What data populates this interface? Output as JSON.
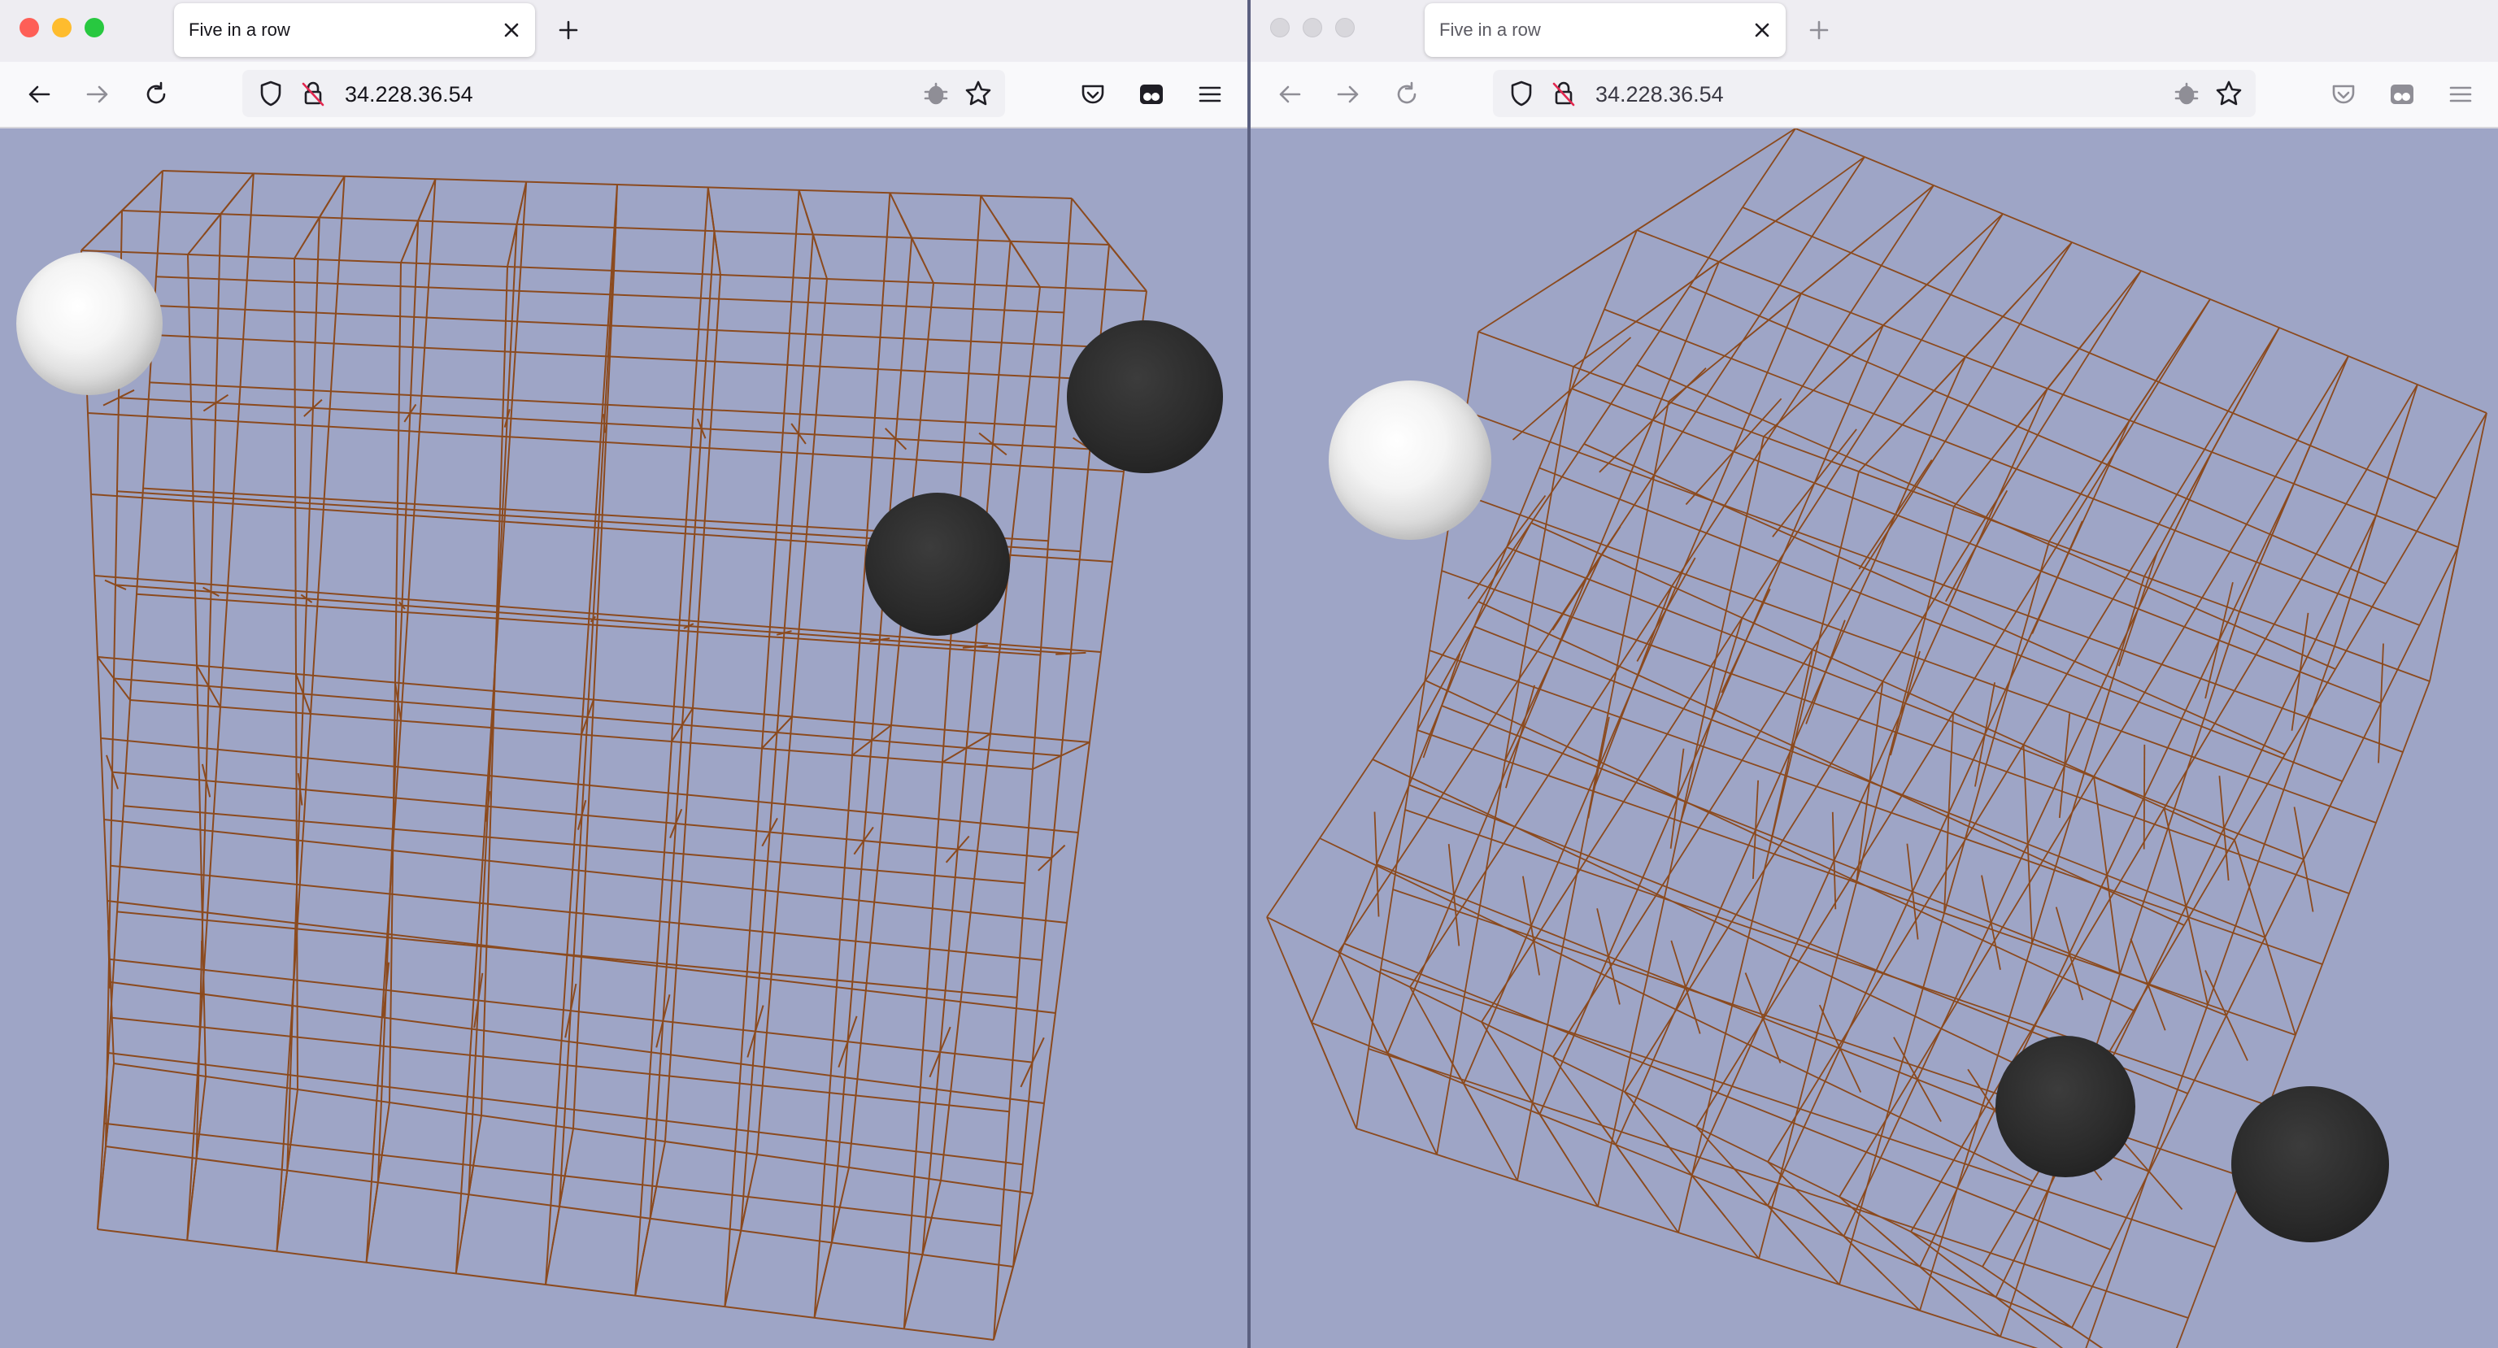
{
  "windows": [
    {
      "id": "left",
      "active": true,
      "traffic_colors": [
        "#fe5f57",
        "#febc2e",
        "#28c840"
      ],
      "tab_title": "Five in a row",
      "url": "34.228.36.54",
      "scene": {
        "white_stones": 1,
        "black_stones": 2
      }
    },
    {
      "id": "right",
      "active": false,
      "traffic_colors": [
        "#d8d7dc",
        "#d8d7dc",
        "#d8d7dc"
      ],
      "tab_title": "Five in a row",
      "url": "34.228.36.54",
      "scene": {
        "white_stones": 1,
        "black_stones": 2
      }
    }
  ],
  "icons": {
    "back": "arrow-left-icon",
    "forward": "arrow-right-icon",
    "reload": "reload-icon",
    "tracking": "shield-icon",
    "insecure": "lock-slash-icon",
    "extension": "bug-icon",
    "bookmark": "star-icon",
    "pocket": "pocket-icon",
    "container": "container-icon",
    "menu": "hamburger-menu-icon",
    "close_tab": "close-icon",
    "new_tab": "plus-icon"
  },
  "colors": {
    "page_background": "#9ea5c6",
    "grid_line": "#8b4a1e",
    "stone_black": "#2b2b2b",
    "stone_white": "#f2f2f2"
  }
}
